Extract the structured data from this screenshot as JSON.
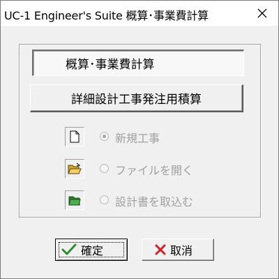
{
  "window": {
    "title": "UC-1 Engineer's Suite 概算･事業費計算",
    "close_glyph": "✕"
  },
  "buttons": {
    "mode_label": "概算･事業費計算",
    "detail_label": "詳細設計工事発注用積算",
    "ok_label": "確定",
    "cancel_label": "取消"
  },
  "options": [
    {
      "label": "新規工事",
      "icon": "new-document-icon",
      "selected": true,
      "enabled": false
    },
    {
      "label": "ファイルを開く",
      "icon": "open-folder-icon",
      "selected": false,
      "enabled": false
    },
    {
      "label": "設計書を取込む",
      "icon": "import-folder-icon",
      "selected": false,
      "enabled": false
    }
  ],
  "colors": {
    "ok_check": "#2e8b2e",
    "cancel_x": "#d42020",
    "folder_yellow": "#e8c040",
    "folder_green": "#3a9a3a",
    "disabled_text": "#a0a0a0"
  }
}
